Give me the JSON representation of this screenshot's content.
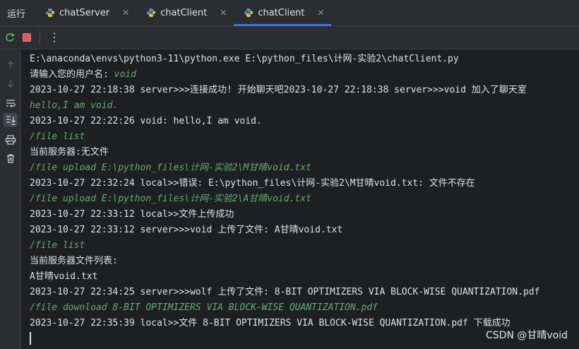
{
  "run_label": "运行",
  "tabs": [
    {
      "label": "chatServer",
      "icon": "python-icon",
      "active": false
    },
    {
      "label": "chatClient",
      "icon": "python-icon",
      "active": false
    },
    {
      "label": "chatClient",
      "icon": "python-icon",
      "active": true
    }
  ],
  "toolbar": {
    "rerun_icon": "rerun-icon",
    "stop_icon": "stop-icon",
    "more_icon": "more-options-icon"
  },
  "gutter": [
    "arrow-up-icon",
    "arrow-down-icon",
    "soft-wrap-icon",
    "scroll-to-end-icon",
    "print-icon",
    "trash-icon"
  ],
  "console": {
    "lines": [
      {
        "text": "E:\\anaconda\\envs\\python3-11\\python.exe E:\\python_files\\计网-实验2\\chatClient.py",
        "kind": "output"
      },
      {
        "prompt": "请输入您的用户名: ",
        "input": "void",
        "kind": "prompt"
      },
      {
        "text": "2023-10-27 22:18:38 server>>>连接成功! 开始聊天吧2023-10-27 22:18:38 server>>>void 加入了聊天室",
        "kind": "output"
      },
      {
        "text": "hello,I am void.",
        "kind": "input"
      },
      {
        "text": "2023-10-27 22:22:26 void: hello,I am void.",
        "kind": "output"
      },
      {
        "text": "/file list",
        "kind": "input"
      },
      {
        "text": "当前服务器:无文件",
        "kind": "output"
      },
      {
        "text": "/file upload E:\\python_files\\计网-实验2\\M甘晴void.txt",
        "kind": "input"
      },
      {
        "text": "2023-10-27 22:32:24 local>>错误: E:\\python_files\\计网-实验2\\M甘晴void.txt: 文件不存在",
        "kind": "output"
      },
      {
        "text": "/file upload E:\\python_files\\计网-实验2\\A甘晴void.txt",
        "kind": "input"
      },
      {
        "text": "2023-10-27 22:33:12 local>>文件上传成功",
        "kind": "output"
      },
      {
        "text": "2023-10-27 22:33:12 server>>>void 上传了文件: A甘晴void.txt",
        "kind": "output"
      },
      {
        "text": "/file list",
        "kind": "input"
      },
      {
        "text": "当前服务器文件列表:",
        "kind": "output"
      },
      {
        "text": "A甘晴void.txt",
        "kind": "output"
      },
      {
        "text": "2023-10-27 22:34:25 server>>>wolf 上传了文件: 8-BIT OPTIMIZERS VIA BLOCK-WISE QUANTIZATION.pdf",
        "kind": "output"
      },
      {
        "text": "/file download 8-BIT OPTIMIZERS VIA BLOCK-WISE QUANTIZATION.pdf",
        "kind": "input"
      },
      {
        "text": "2023-10-27 22:35:39 local>>文件 8-BIT OPTIMIZERS VIA BLOCK-WISE QUANTIZATION.pdf 下载成功",
        "kind": "output"
      }
    ]
  },
  "watermark": "CSDN @甘晴void",
  "colors": {
    "background": "#1e1f22",
    "panel": "#2b2d30",
    "accent": "#3574f0",
    "input_text": "#5fae6f",
    "stop_red": "#db5c5c",
    "rerun_green": "#5fb865"
  }
}
